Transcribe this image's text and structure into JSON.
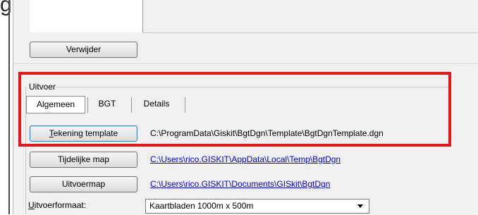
{
  "page_heading": "g",
  "top": {
    "remove_button": "Verwijder"
  },
  "output_group": {
    "label": "Uitvoer",
    "tabs": [
      {
        "label": "Algemeen",
        "active": true
      },
      {
        "label": "BGT",
        "active": false
      },
      {
        "label": "Details",
        "active": false
      }
    ],
    "rows": [
      {
        "button_label": "Tekening template",
        "button_accel": "T",
        "button_rest": "ekening template",
        "path": "C:\\ProgramData\\Giskit\\BgtDgn\\Template\\BgtDgnTemplate.dgn",
        "is_link": false
      },
      {
        "button_label": "Tijdelijke map",
        "path": "C:\\Users\\rico.GISKIT\\AppData\\Local\\Temp\\BgtDgn",
        "is_link": true
      },
      {
        "button_label": "Uitvoermap",
        "path": "C:\\Users\\rico.GISKIT\\Documents\\GISkit\\BgtDgn",
        "is_link": true
      }
    ],
    "format": {
      "label": "Uitvoerformaat:",
      "label_accel": "U",
      "label_rest": "itvoerformaat:",
      "selected": "Kaartbladen 1000m x 500m"
    }
  },
  "colors": {
    "highlight": "#e8141a",
    "link": "#0000ee",
    "panel": "#f0f0f0"
  }
}
